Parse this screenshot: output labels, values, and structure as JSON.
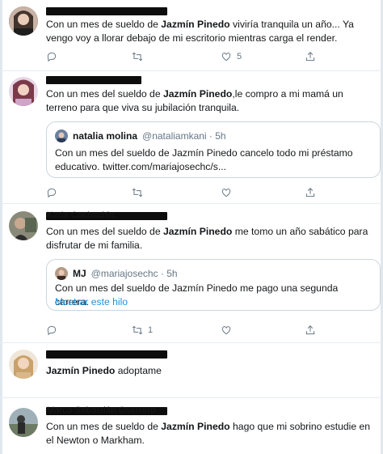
{
  "tweets": [
    {
      "redacted_name": "",
      "prefix": "Con un mes de sueldo de ",
      "bold": "Jazmín Pinedo",
      "suffix": " viviría tranquila un año... Ya vengo voy a llorar debajo de mi escritorio mientras carga el render.",
      "reply_count": "",
      "retweet_count": "",
      "like_count": "5"
    },
    {
      "redacted_name": "",
      "prefix": "Con un mes del sueldo de ",
      "bold": "Jazmín Pinedo",
      "suffix": ",le compro a mi mamá un terreno para que viva su jubilación tranquila.",
      "quote": {
        "name": "natalia molina",
        "handle": "@nataliamkani · 5h",
        "text": "Con un mes del sueldo de Jazmín Pinedo cancelo todo mi préstamo educativo. twitter.com/mariajosechc/s..."
      }
    },
    {
      "redacted_name": "Karla Cochachin",
      "prefix": "Con un mes del sueldo de ",
      "bold": "Jazmín Pinedo",
      "suffix": " me tomo un año sabático para disfrutar de mi familia.",
      "quote": {
        "name": "MJ",
        "handle": "@mariajosechc · 5h",
        "text": "Con un mes del sueldo de Jazmín Pinedo me pago una segunda carrera.",
        "link": "Mostrar este hilo"
      },
      "retweet_count": "1"
    },
    {
      "redacted_name": "",
      "prefix": "",
      "bold": "Jazmín Pinedo",
      "suffix": " adoptame"
    },
    {
      "redacted_name": "Marco Sebastián Guerrero",
      "prefix": "Con un mes de sueldo de ",
      "bold": "Jazmín Pinedo",
      "suffix": " hago que mi sobrino estudie en el Newton o Markham."
    }
  ],
  "colors": {
    "text": "#14171a",
    "secondary": "#657786",
    "link": "#1b95e0",
    "border": "#e6ecf0",
    "redaction": "#0d0d0d"
  },
  "icons": [
    "reply-icon",
    "retweet-icon",
    "like-icon",
    "share-icon"
  ]
}
